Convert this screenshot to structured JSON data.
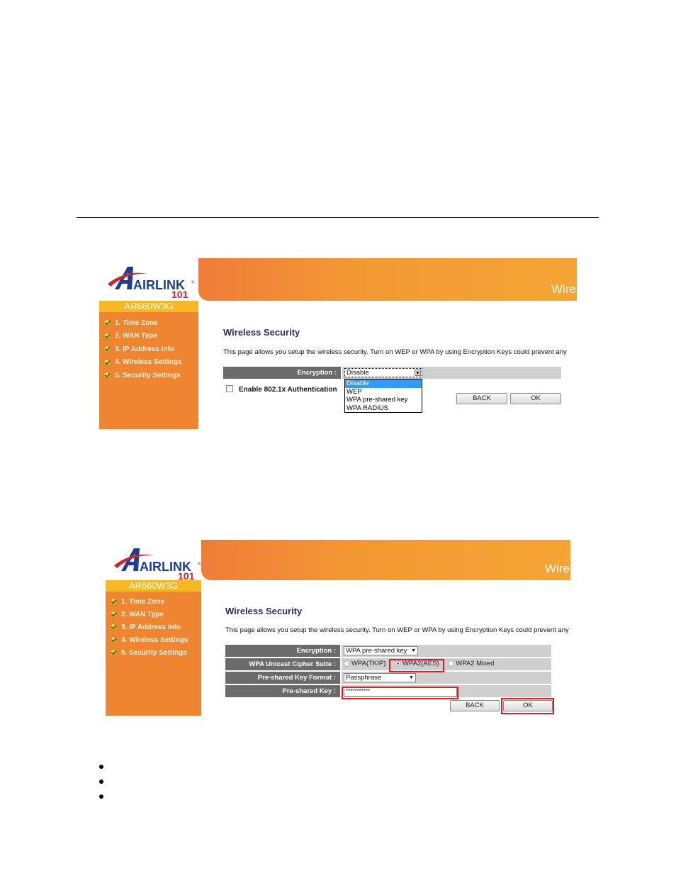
{
  "brand": {
    "logo_text": "AIRLINK",
    "logo_number": "101",
    "registered_mark": "®",
    "model": "AR660W3G"
  },
  "banner_title": "Wireless",
  "sidebar_items": [
    {
      "label": "1. Time Zone"
    },
    {
      "label": "2. WAN Type"
    },
    {
      "label": "3. IP Address Info"
    },
    {
      "label": "4. Wireless Settings"
    },
    {
      "label": "5. Security Settings"
    }
  ],
  "screenshot1": {
    "heading": "Wireless Security",
    "description": "This page allows you setup the wireless security. Turn on WEP or WPA by using Encryption Keys could prevent any",
    "encryption_label": "Encryption :",
    "encryption_value": "Disable",
    "dropdown_open": true,
    "dropdown_options": [
      "Disable",
      "WEP",
      "WPA pre-shared key",
      "WPA RADIUS"
    ],
    "dropdown_highlighted": "Disable",
    "checkbox_label": "Enable 802.1x Authentication",
    "checkbox_checked": false,
    "back_label": "BACK",
    "ok_label": "OK"
  },
  "screenshot2": {
    "heading": "Wireless Security",
    "description": "This page allows you setup the wireless security. Turn on WEP or WPA by using Encryption Keys could prevent any u",
    "rows": {
      "encryption": {
        "label": "Encryption :",
        "value": "WPA pre-shared key"
      },
      "cipher": {
        "label": "WPA Unicast Cipher Suite :",
        "options": [
          "WPA(TKIP)",
          "WPA2(AES)",
          "WPA2 Mixed"
        ],
        "selected": "WPA2(AES)"
      },
      "key_format": {
        "label": "Pre-shared Key Format :",
        "value": "Passphrase"
      },
      "key": {
        "label": "Pre-shared Key :",
        "value": "***********"
      }
    },
    "back_label": "BACK",
    "ok_label": "OK",
    "highlight_color": "#d61f2b"
  },
  "colors": {
    "banner_start": "#ef7d38",
    "banner_end": "#f4a534",
    "sidebar": "#f08531",
    "model_bar": "#f8b824",
    "label_cell": "#6b6b6b",
    "value_cell": "#cfcfcf",
    "heading": "#2b2b5c",
    "dropdown_selected": "#3399ff"
  },
  "bullet_count": 3
}
